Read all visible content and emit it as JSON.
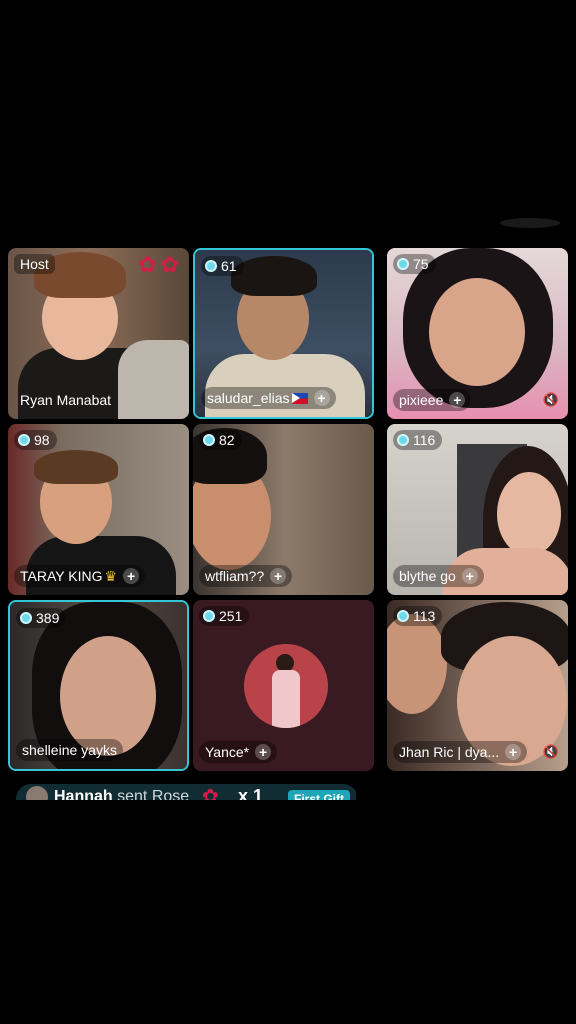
{
  "host": {
    "label": "Host",
    "name": "Ryan Manabat"
  },
  "participants": [
    {
      "count": "61",
      "name": "saludar_elias"
    },
    {
      "count": "75",
      "name": "pixieee"
    },
    {
      "count": "98",
      "name": "TARAY KING"
    },
    {
      "count": "82",
      "name": "wtfliam??"
    },
    {
      "count": "116",
      "name": "blythe go"
    },
    {
      "count": "389",
      "name": "shelleine yayks"
    },
    {
      "count": "251",
      "name": "Yance*"
    },
    {
      "count": "113",
      "name": "Jhan Ric | dya..."
    }
  ],
  "gift_banner": {
    "sender": "Hannah",
    "action": "sent Rose",
    "multiplier": "x 1",
    "tag": "First Gift"
  },
  "colors": {
    "active_border": "#34c6d6",
    "badge_dot": "#6fd8ea",
    "rose": "#d21e46"
  }
}
